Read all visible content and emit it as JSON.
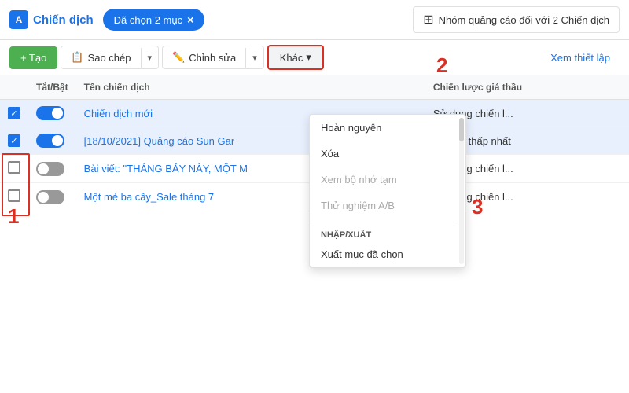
{
  "header": {
    "brand_icon": "A",
    "brand_label": "Chiến dịch",
    "selected_badge": "Đã chọn 2 mục",
    "selected_close": "×",
    "campaign_group_label": "Nhóm quảng cáo đối với 2 Chiến dịch"
  },
  "toolbar": {
    "create_label": "+ Tạo",
    "copy_label": "Sao chép",
    "edit_label": "Chỉnh sửa",
    "other_label": "Khác",
    "dropdown_arrow": "▾",
    "view_settings_label": "Xem thiết lập"
  },
  "dropdown": {
    "item1": "Hoàn nguyên",
    "item2": "Xóa",
    "item3": "Xem bộ nhớ tạm",
    "item4": "Thử nghiệm A/B",
    "section1": "Nhập/Xuất",
    "item5": "Xuất mục đã chọn"
  },
  "table": {
    "col_toggle": "Tắt/Bật",
    "col_name": "Tên chiến dịch",
    "col_strategy": "Chiến lược giá thầu",
    "rows": [
      {
        "checked": true,
        "toggle": "on",
        "name": "Chiến dịch mới",
        "strategy": "Sử dụng chiến l...",
        "selected": true
      },
      {
        "checked": true,
        "toggle": "on",
        "name": "[18/10/2021] Quảng cáo Sun Gar",
        "strategy": "Chi phí thấp nhất",
        "selected": true
      },
      {
        "checked": false,
        "toggle": "off",
        "name": "Bài viết: \"THÁNG BẢY NÀY, MỘT M",
        "strategy": "Sử dụng chiến l...",
        "selected": false
      },
      {
        "checked": false,
        "toggle": "off",
        "name": "Một mẻ ba cây_Sale tháng 7",
        "strategy": "Sử dụng chiến l...",
        "selected": false
      }
    ]
  },
  "annotations": {
    "num1": "1",
    "num2": "2",
    "num3": "3"
  }
}
